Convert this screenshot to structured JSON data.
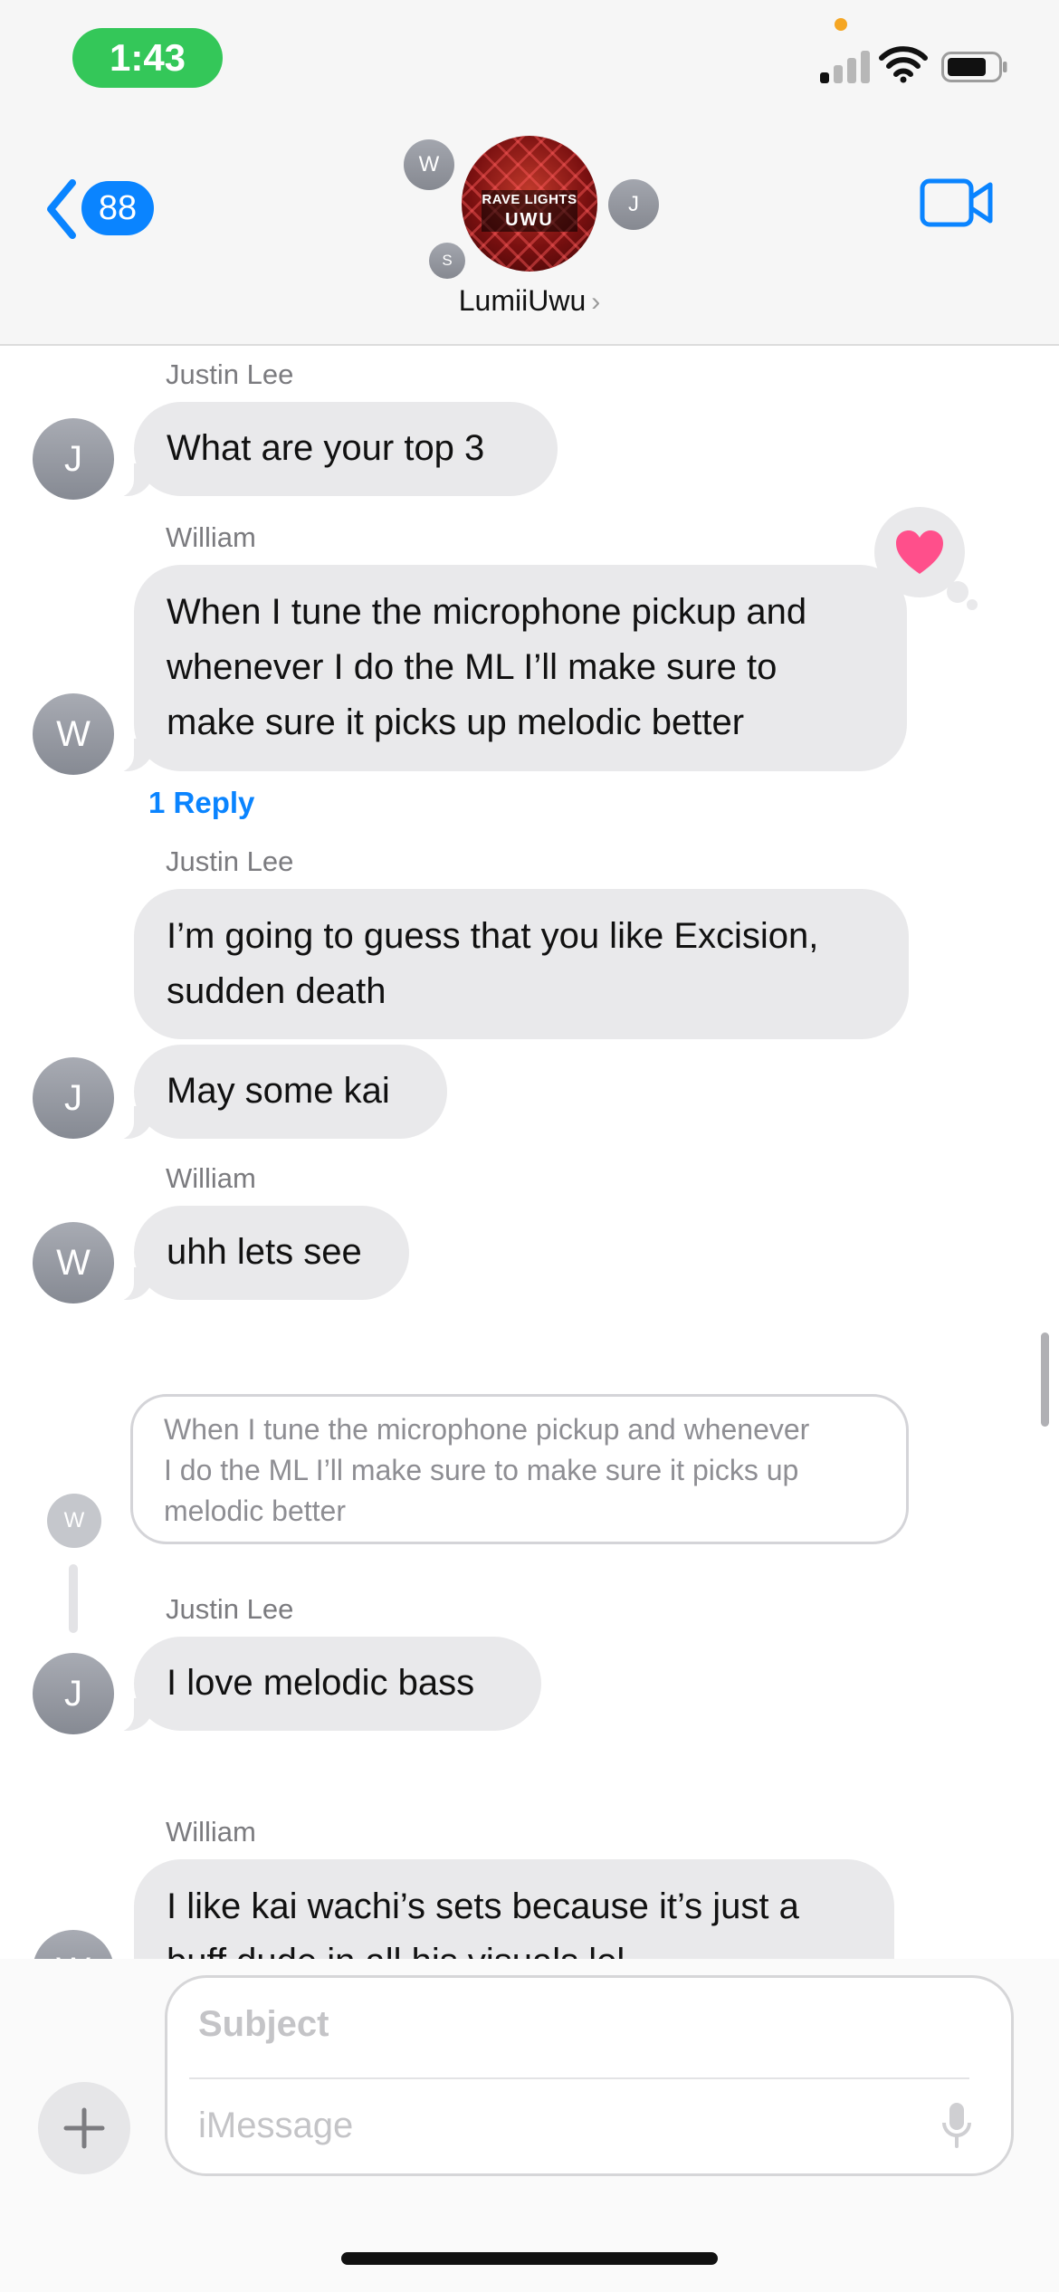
{
  "status_bar": {
    "time": "1:43",
    "signal_bars": 4,
    "signal_active": 1,
    "battery_level": 0.75
  },
  "header": {
    "back_count": "88",
    "group_name": "LumiiUwu",
    "group_image_text_line1": "RAVE LIGHTS",
    "group_image_text_line2": "UWU",
    "member_initials": [
      "W",
      "J",
      "S"
    ]
  },
  "messages": [
    {
      "sender": "Justin Lee",
      "avatar": "J",
      "text": "What are your top 3"
    },
    {
      "sender": "William",
      "avatar": "W",
      "text_lines": [
        "When I tune the microphone pickup and",
        "whenever I do the ML I’ll make sure to",
        "make sure it picks up melodic better"
      ],
      "reaction": "heart",
      "reply_label": "1 Reply"
    },
    {
      "sender": "Justin Lee",
      "avatar": "J",
      "text_lines": [
        "I’m going to guess that you like Excision,",
        "sudden death"
      ]
    },
    {
      "text": "May some kai"
    },
    {
      "sender": "William",
      "avatar": "W",
      "text": "uhh lets see"
    },
    {
      "quoted_avatar": "W",
      "quoted_lines": [
        "When I tune the microphone pickup and whenever",
        "I do the ML I’ll make sure to make sure it picks up",
        "melodic better"
      ]
    },
    {
      "sender": "Justin Lee",
      "avatar": "J",
      "text": "I love melodic bass"
    },
    {
      "sender": "William",
      "avatar": "W",
      "text_lines": [
        "I like kai wachi’s sets because it’s just a",
        "buff dude in all his visuals lol"
      ]
    }
  ],
  "compose": {
    "subject_placeholder": "Subject",
    "message_placeholder": "iMessage"
  },
  "colors": {
    "accent": "#0a84ff",
    "bubble_incoming": "#e9e9eb",
    "time_pill": "#34c759",
    "heart": "#ff4f8b"
  }
}
